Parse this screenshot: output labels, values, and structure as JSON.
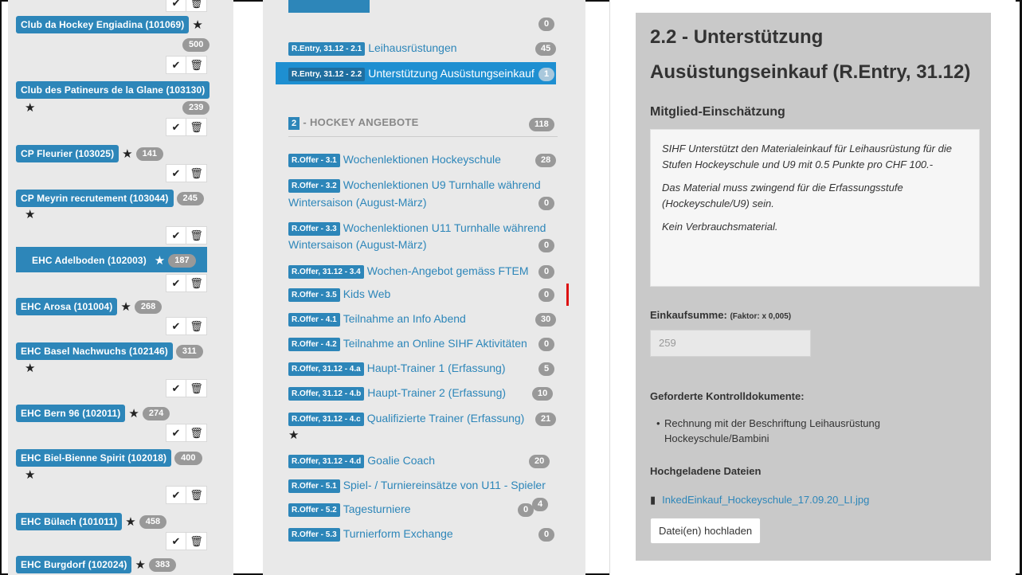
{
  "clubs": [
    {
      "label": "Club da Hockey Engiadina  (101069)",
      "count": "500"
    },
    {
      "label": "Club des Patineurs de la Glane  (103130)",
      "count": "239"
    },
    {
      "label": "CP Fleurier  (103025)",
      "count": "141"
    },
    {
      "label": "CP Meyrin recrutement  (103044)",
      "count": "245"
    },
    {
      "label": "EHC Adelboden  (102003)",
      "count": "187"
    },
    {
      "label": "EHC Arosa  (101004)",
      "count": "268"
    },
    {
      "label": "EHC Basel Nachwuchs  (102146)",
      "count": "311"
    },
    {
      "label": "EHC Bern 96  (102011)",
      "count": "274"
    },
    {
      "label": "EHC Biel-Bienne Spirit  (102018)",
      "count": "400"
    },
    {
      "label": "EHC Bülach  (101011)",
      "count": "458"
    },
    {
      "label": "EHC Burgdorf  (102024)",
      "count": "383"
    }
  ],
  "offers": {
    "top_count": "0",
    "items": [
      {
        "tag": "R.Entry, 31.12 - 2.1",
        "label": "Leihausrüstungen",
        "count": "45"
      },
      {
        "tag": "R.Entry, 31.12 - 2.2",
        "label": "Unterstützung Ausüstungseinkauf",
        "count": "1"
      }
    ],
    "section": {
      "num": "2",
      "title": "- HOCKEY ANGEBOTE",
      "count": "118"
    },
    "list": [
      {
        "tag": "R.Offer - 3.1",
        "label": "Wochenlektionen Hockeyschule",
        "count": "28"
      },
      {
        "tag": "R.Offer - 3.2",
        "label": "Wochenlektionen U9 Turnhalle während",
        "label2": "Wintersaison (August-März)",
        "count": "0"
      },
      {
        "tag": "R.Offer - 3.3",
        "label": "Wochenlektionen U11 Turnhalle während",
        "label2": "Wintersaison (August-März)",
        "count": "0"
      },
      {
        "tag": "R.Offer, 31.12 - 3.4",
        "label": "Wochen-Angebot gemäss FTEM",
        "count": "0"
      },
      {
        "tag": "R.Offer - 3.5",
        "label": "Kids Web",
        "count": "0"
      },
      {
        "tag": "R.Offer - 4.1",
        "label": "Teilnahme an Info Abend",
        "count": "30"
      },
      {
        "tag": "R.Offer - 4.2",
        "label": "Teilnahme an Online SIHF Aktivitäten",
        "count": "0"
      },
      {
        "tag": "R.Offer, 31.12 - 4.a",
        "label": "Haupt-Trainer 1 (Erfassung)",
        "count": "5"
      },
      {
        "tag": "R.Offer, 31.12 - 4.b",
        "label": "Haupt-Trainer 2 (Erfassung)",
        "count": "10"
      },
      {
        "tag": "R.Offer, 31.12 - 4.c",
        "label": "Qualifizierte Trainer (Erfassung)",
        "count": "21"
      },
      {
        "tag": "R.Offer, 31.12 - 4.d",
        "label": "Goalie Coach",
        "count": "20"
      },
      {
        "tag": "R.Offer - 5.1",
        "label": "Spiel- / Turniereinsätze von U11 - Spieler",
        "count": ""
      },
      {
        "tag": "R.Offer - 5.2",
        "label": "Tagesturniere",
        "count": "0",
        "count2": "4"
      },
      {
        "tag": "R.Offer - 5.3",
        "label": "Turnierform Exchange",
        "count": "0"
      }
    ]
  },
  "detail": {
    "title_line1": "2.2 - Unterstützung",
    "title_line2": "Ausüstungseinkauf (R.Entry, 31.12)",
    "subtitle": "Mitglied-Einschätzung",
    "note_p1": "SIHF Unterstützt den Materialeinkauf für Leihausrüstung für die Stufen Hockeyschule und U9 mit 0.5 Punkte pro CHF 100.-",
    "note_p2": "Das Material muss zwingend für die Erfassungsstufe (Hockeyschule/U9) sein.",
    "note_p3": "Kein Verbrauchsmaterial.",
    "field_label": "Einkaufsumme:",
    "field_factor": "(Faktor: x 0,005)",
    "field_value": "259",
    "docs_label": "Geforderte Kontrolldokumente:",
    "docs_item": "Rechnung mit der Beschriftung Leihausrüstung Hockeyschule/Bambini",
    "uploaded_label": "Hochgeladene Dateien",
    "file_name": "InkedEinkauf_Hockeyschule_17.09.20_LI.jpg",
    "upload_button": "Datei(en) hochladen"
  }
}
